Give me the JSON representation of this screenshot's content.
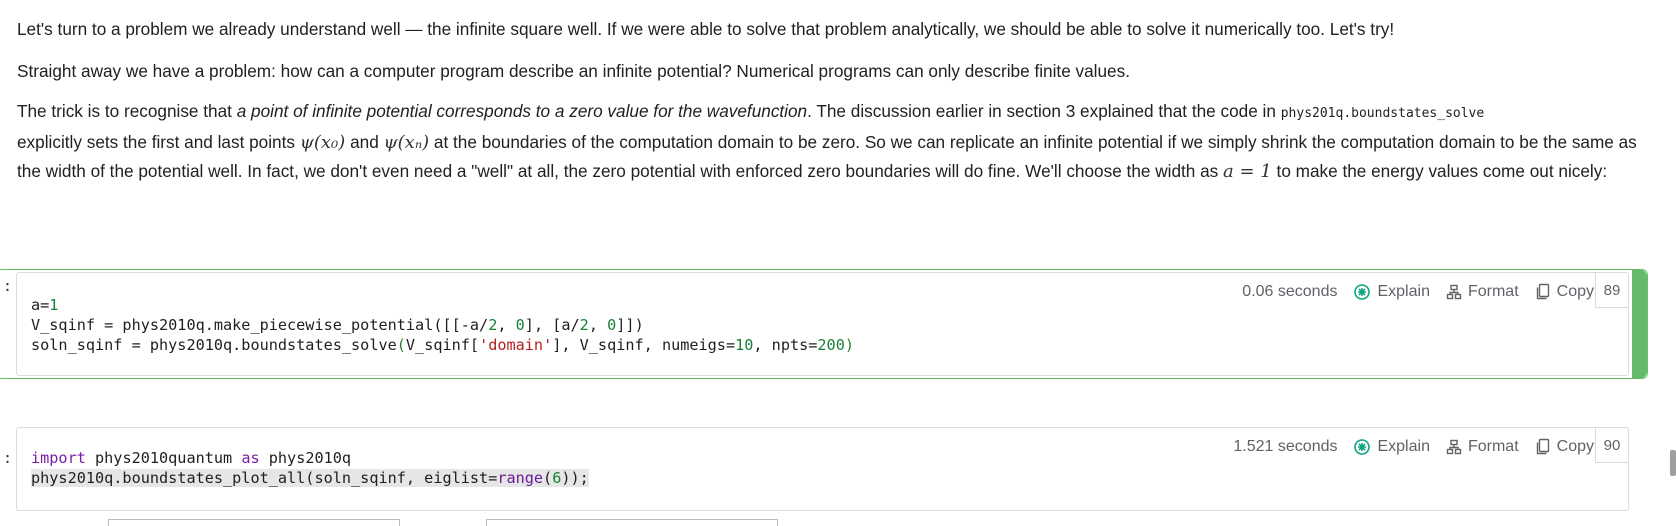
{
  "markdown": {
    "p1": "Let's turn to a problem we already understand well — the infinite square well. If we were able to solve that problem analytically, we should be able to solve it numerically too. Let's try!",
    "p2": "Straight away we have a problem: how can a computer program describe an infinite potential? Numerical programs can only describe finite values.",
    "p3_a": "The trick is to recognise that ",
    "p3_em": "a point of infinite potential corresponds to a zero value for the wavefunction",
    "p3_b": ". The discussion earlier in section 3 explained that the code in ",
    "p3_code": "phys201q.boundstates_solve",
    "p3_c": " explicitly sets the first and last points ",
    "p3_math1": "ψ(x₀)",
    "p3_d": " and ",
    "p3_math2": "ψ(xₙ)",
    "p3_e": " at the boundaries of the computation domain to be zero. So we can replicate an infinite potential if we simply shrink the computation domain to be the same as the width of the potential well. In fact, we don't even need a \"well\" at all, the zero potential with enforced zero boundaries will do fine. We'll choose the width as ",
    "p3_math3": "a = 1",
    "p3_f": " to make the energy values come out nicely:"
  },
  "cells": [
    {
      "prompt": ":",
      "time": "0.06 seconds",
      "exec_count": "89",
      "code": {
        "l1_a": "a=",
        "l1_n": "1",
        "l2_a": "V_sqinf = phys2010q.make_piecewise_potential([[-a/",
        "l2_n1": "2",
        "l2_b": ", ",
        "l2_n2": "0",
        "l2_c": "], [a/",
        "l2_n3": "2",
        "l2_d": ", ",
        "l2_n4": "0",
        "l2_e": "]])",
        "l3_a": "soln_sqinf = phys2010q.boundstates_solve",
        "l3_p1": "(",
        "l3_b": "V_sqinf[",
        "l3_s": "'domain'",
        "l3_c": "], V_sqinf, numeigs=",
        "l3_n1": "10",
        "l3_d": ", npts=",
        "l3_n2": "200",
        "l3_p2": ")"
      }
    },
    {
      "prompt": ":",
      "time": "1.521 seconds",
      "exec_count": "90",
      "code": {
        "l1_kw1": "import",
        "l1_a": " phys2010quantum ",
        "l1_kw2": "as",
        "l1_b": " phys2010q",
        "l2_a": "phys2010q.boundstates_plot_all(soln_sqinf, eiglist=",
        "l2_bi": "range",
        "l2_b": "(",
        "l2_n": "6",
        "l2_c": "));"
      }
    }
  ],
  "toolbar": {
    "explain": "Explain",
    "format": "Format",
    "copy": "Copy",
    "icons": [
      "openai-icon",
      "format-icon",
      "copy-icon"
    ]
  },
  "colors": {
    "active_bar": "#66bb6a",
    "number": "#1a7f37",
    "string": "#b22222",
    "keyword": "#7b1fa2"
  }
}
